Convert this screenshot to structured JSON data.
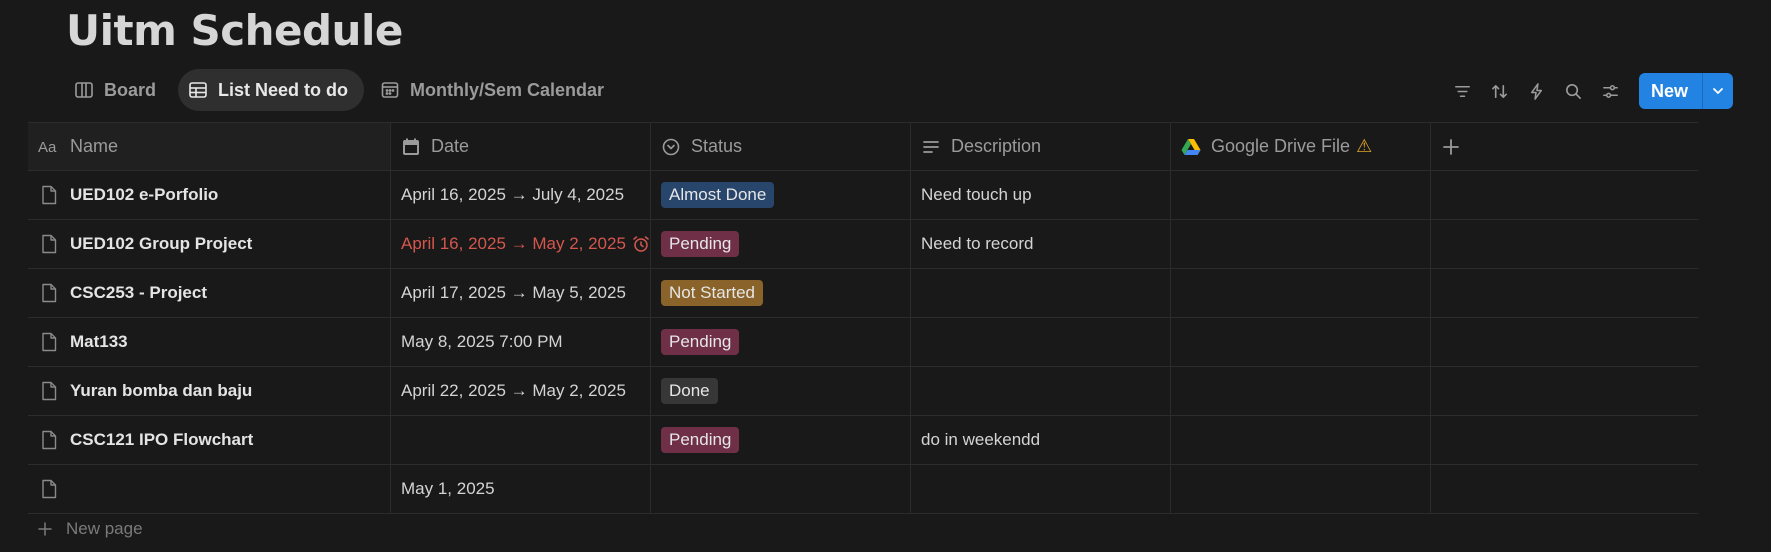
{
  "page": {
    "title": "Uitm Schedule"
  },
  "views": [
    {
      "label": "Board",
      "icon": "board-icon"
    },
    {
      "label": "List Need to do",
      "icon": "table-icon",
      "active": true
    },
    {
      "label": "Monthly/Sem Calendar",
      "icon": "calendar-icon"
    }
  ],
  "toolbar": {
    "icons": [
      "filter-icon",
      "sort-icon",
      "automation-icon",
      "search-icon",
      "settings-icon"
    ],
    "new_label": "New"
  },
  "columns": [
    {
      "label": "Name",
      "icon": "text-icon"
    },
    {
      "label": "Date",
      "icon": "calendar-icon"
    },
    {
      "label": "Status",
      "icon": "status-icon"
    },
    {
      "label": "Description",
      "icon": "text-lines-icon"
    },
    {
      "label": "Google Drive File",
      "icon": "google-drive-icon",
      "warning": "⚠"
    }
  ],
  "rows": [
    {
      "name": "UED102 e-Porfolio",
      "date": "April 16, 2025 → July 4, 2025",
      "status": "Almost Done",
      "description": "Need touch up"
    },
    {
      "name": "UED102 Group Project",
      "date": "April 16, 2025 → May 2, 2025",
      "overdue": true,
      "status": "Pending",
      "description": "Need to record"
    },
    {
      "name": "CSC253 - Project",
      "date": "April 17, 2025 → May 5, 2025",
      "status": "Not Started",
      "description": ""
    },
    {
      "name": "Mat133",
      "date": "May 8, 2025 7:00 PM",
      "status": "Pending",
      "description": ""
    },
    {
      "name": "Yuran bomba dan baju",
      "date": "April 22, 2025 → May 2, 2025",
      "status": "Done",
      "description": ""
    },
    {
      "name": "CSC121 IPO Flowchart",
      "date": "",
      "status": "Pending",
      "description": "do in weekendd"
    },
    {
      "name": "",
      "date": "May 1, 2025",
      "status": "",
      "description": ""
    }
  ],
  "status_colors": {
    "Almost Done": "#28456c",
    "Pending": "#6e2f47",
    "Not Started": "#89632a",
    "Done": "#373737"
  },
  "new_page_label": "New page"
}
